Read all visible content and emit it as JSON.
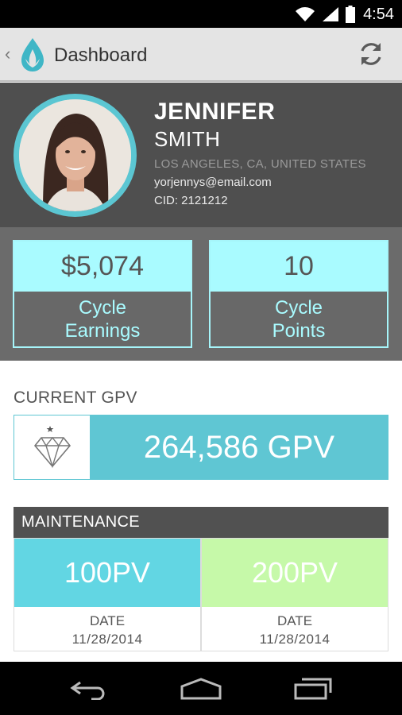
{
  "status_bar": {
    "time": "4:54",
    "icons": [
      "wifi-icon",
      "signal-icon",
      "battery-icon"
    ]
  },
  "action_bar": {
    "title": "Dashboard",
    "back_icon": "chevron-left-icon",
    "logo_icon": "droplet-leaf-logo-icon",
    "refresh_icon": "refresh-icon"
  },
  "profile": {
    "first_name": "JENNIFER",
    "last_name": "SMITH",
    "location": "LOS ANGELES, CA, UNITED STATES",
    "email": "yorjennys@email.com",
    "cid": "CID: 2121212"
  },
  "stats": {
    "cycle_earnings": {
      "value": "$5,074",
      "label_line1": "Cycle",
      "label_line2": "Earnings"
    },
    "cycle_points": {
      "value": "10",
      "label_line1": "Cycle",
      "label_line2": "Points"
    }
  },
  "gpv": {
    "heading": "CURRENT GPV",
    "value": "264,586 GPV",
    "icon": "diamond-icon"
  },
  "maintenance": {
    "heading": "MAINTENANCE",
    "cards": [
      {
        "value": "100PV",
        "date_label": "DATE",
        "date": "11/28/2014"
      },
      {
        "value": "200PV",
        "date_label": "DATE",
        "date": "11/28/2014"
      }
    ]
  },
  "nav_bar": {
    "icons": [
      "back-nav-icon",
      "home-nav-icon",
      "recents-nav-icon"
    ]
  },
  "colors": {
    "accent_cyan": "#5fc6d3",
    "stat_cyan": "#a9fbff",
    "maint_green": "#c6f9a9",
    "profile_bg": "#4f4f4f"
  }
}
